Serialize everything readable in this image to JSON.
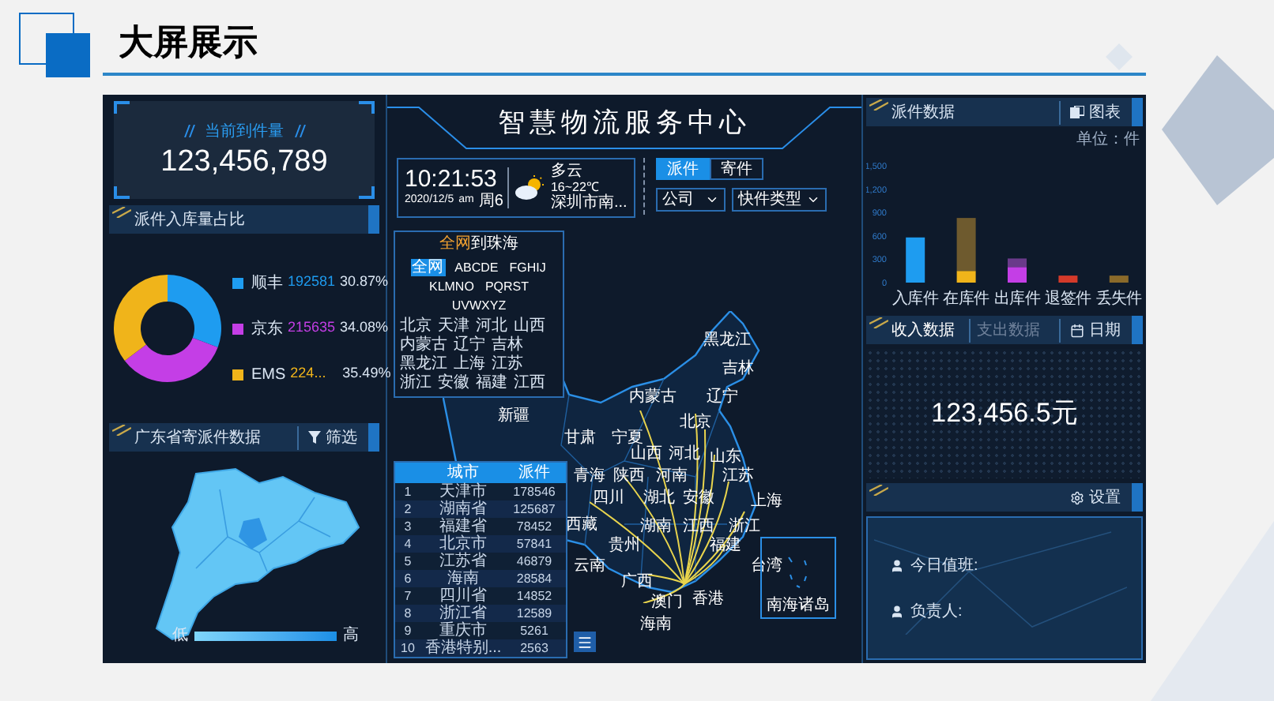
{
  "page": {
    "title": "大屏展示"
  },
  "left": {
    "arrivals": {
      "label": "当前到件量",
      "value": "123,456,789"
    },
    "share_panel": {
      "title": "派件入库量占比",
      "legend": [
        {
          "count": "192581",
          "percent": "30.87%",
          "color": "#1e9cf0"
        },
        {
          "count": "215635",
          "percent": "34.08%",
          "color": "#c43ee6"
        },
        {
          "count": "224...",
          "percent": "35.49%",
          "color": "#f0b41a"
        }
      ],
      "chart_data": {
        "type": "donut",
        "categories": [
          "顺丰",
          "京东",
          "EMS"
        ],
        "values": [
          30.87,
          34.08,
          35.49
        ]
      }
    },
    "province_panel": {
      "title": "广东省寄派件数据",
      "filter_button": "筛选",
      "legend_low": "低",
      "legend_high": "高"
    }
  },
  "center": {
    "title": "智慧物流服务中心",
    "clock": {
      "time": "10:21:53",
      "date": "2020/12/5",
      "period": "am",
      "weekday": "周6"
    },
    "weather": {
      "condition": "多云",
      "temperature": "16~22℃",
      "location": "深圳市南..."
    },
    "mode_tabs": [
      {
        "label": "派件",
        "selected": true
      },
      {
        "label": "寄件",
        "selected": false
      }
    ],
    "dropdowns": [
      {
        "value": "公司"
      },
      {
        "value": "快件类型"
      }
    ],
    "region_filter": {
      "title_highlight": "全网",
      "title_rest": "到珠海",
      "letter_tabs": [
        {
          "label": "全网",
          "selected": true
        },
        {
          "label": "ABCDE",
          "selected": false
        },
        {
          "label": "FGHIJ",
          "selected": false
        },
        {
          "label": "KLMNO",
          "selected": false
        },
        {
          "label": "PQRST",
          "selected": false
        },
        {
          "label": "UVWXYZ",
          "selected": false
        }
      ],
      "provinces": [
        "北京",
        "天津",
        "河北",
        "山西",
        "内蒙古",
        "辽宁",
        "吉林",
        "黑龙江",
        "上海",
        "江苏",
        "浙江",
        "安徽",
        "福建",
        "江西"
      ]
    },
    "map_labels": [
      "黑龙江",
      "吉林",
      "内蒙古",
      "辽宁",
      "新疆",
      "北京",
      "甘肃",
      "宁夏",
      "山西",
      "河北",
      "山东",
      "青海",
      "陕西",
      "河南",
      "江苏",
      "四川",
      "湖北",
      "安徽",
      "上海",
      "西藏",
      "湖南",
      "江西",
      "浙江",
      "贵州",
      "福建",
      "云南",
      "台湾",
      "广西",
      "香港",
      "澳门",
      "海南"
    ],
    "inset_label": "南海诸岛",
    "ranking_table": {
      "columns": [
        "城市",
        "派件"
      ],
      "rows": [
        {
          "rank": "1",
          "city": "天津市",
          "count": "178546"
        },
        {
          "rank": "2",
          "city": "湖南省",
          "count": "125687"
        },
        {
          "rank": "3",
          "city": "福建省",
          "count": "78452"
        },
        {
          "rank": "4",
          "city": "北京市",
          "count": "57841"
        },
        {
          "rank": "5",
          "city": "江苏省",
          "count": "46879"
        },
        {
          "rank": "6",
          "city": "海南",
          "count": "28584"
        },
        {
          "rank": "7",
          "city": "四川省",
          "count": "14852"
        },
        {
          "rank": "8",
          "city": "浙江省",
          "count": "12589"
        },
        {
          "rank": "9",
          "city": "重庆市",
          "count": "5261"
        },
        {
          "rank": "10",
          "city": "香港特别...",
          "count": "2563"
        }
      ]
    }
  },
  "right": {
    "dispatch_panel": {
      "title": "派件数据",
      "chart_button": "图表",
      "unit": "单位：件",
      "chart_data": {
        "type": "bar",
        "categories": [
          "入库件",
          "在库件",
          "出库件",
          "退签件",
          "丢失件"
        ],
        "ylim": [
          0,
          1500
        ],
        "yticks": [
          0,
          300,
          600,
          900,
          {
            "value": 1200,
            "label": "1,200"
          },
          {
            "value": 1500,
            "label": "1,500"
          }
        ],
        "stacked": true,
        "series": [
          {
            "colors": [
              "#1e9cf0",
              "#f0b41a",
              "#c43ee6",
              "#d43a2a",
              "#8a6a2a"
            ],
            "values": [
              580,
              150,
              200,
              90,
              90
            ]
          },
          {
            "colors": [
              null,
              "#6e5a2e",
              "#6a3a8a",
              null,
              null
            ],
            "values": [
              null,
              680,
              110,
              null,
              null
            ]
          }
        ]
      }
    },
    "income_panel": {
      "tabs": [
        {
          "label": "收入数据",
          "selected": true
        },
        {
          "label": "支出数据",
          "selected": false
        }
      ],
      "date_button": "日期",
      "amount": "123,456.5元"
    },
    "duty_panel": {
      "settings_button": "设置",
      "fields": [
        "今日值班:",
        "负责人:"
      ]
    }
  }
}
